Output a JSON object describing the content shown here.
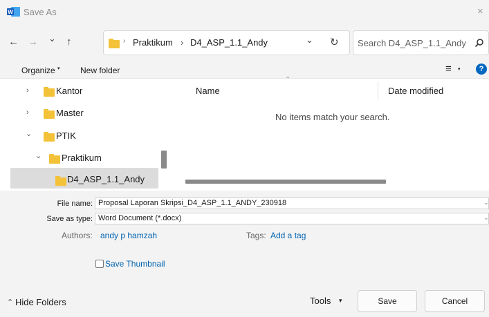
{
  "window": {
    "title": "Save As",
    "close_glyph": "×"
  },
  "nav": {
    "back_glyph": "←",
    "forward_glyph": "→",
    "recent_glyph": "⌄",
    "up_glyph": "↑",
    "dropdown_glyph": "⌄",
    "refresh_glyph": "↻"
  },
  "address": {
    "sep1": "›",
    "crumbs": [
      "Praktikum",
      "D4_ASP_1.1_Andy"
    ],
    "sep2": "›"
  },
  "search": {
    "placeholder": "Search D4_ASP_1.1_Andy",
    "icon": "search-icon"
  },
  "commandbar": {
    "organize": "Organize",
    "organize_caret": "▾",
    "new_folder": "New folder",
    "view_glyph": "≡",
    "view_caret": "▾",
    "help": "?"
  },
  "tree": {
    "items": [
      {
        "label": "Kantor",
        "chevron": "›"
      },
      {
        "label": "Master",
        "chevron": "›"
      },
      {
        "label": "PTIK",
        "chevron": "⌄"
      },
      {
        "label": "Praktikum",
        "chevron": "⌄"
      },
      {
        "label": "D4_ASP_1.1_Andy",
        "chevron": ""
      }
    ]
  },
  "content": {
    "columns": [
      "Name",
      "Date modified"
    ],
    "sort_glyph": "⌃",
    "empty_message": "No items match your search."
  },
  "form": {
    "file_name_label": "File name:",
    "file_name_value": "Proposal Laporan Skripsi_D4_ASP_1.1_ANDY_230918",
    "type_label": "Save as type:",
    "type_value": "Word Document (*.docx)",
    "dd_glyph": "⌄",
    "authors_label": "Authors:",
    "authors_value": "andy p hamzah",
    "tags_label": "Tags:",
    "tags_value": "Add a tag",
    "thumbnail_label": "Save Thumbnail"
  },
  "footer": {
    "hide_folders": "Hide Folders",
    "hide_glyph": "⌃",
    "tools": "Tools",
    "tools_caret": "▾",
    "save": "Save",
    "cancel": "Cancel"
  },
  "colors": {
    "accent": "#0067c0",
    "folder": "#f3c238",
    "link": "#0063b1"
  }
}
